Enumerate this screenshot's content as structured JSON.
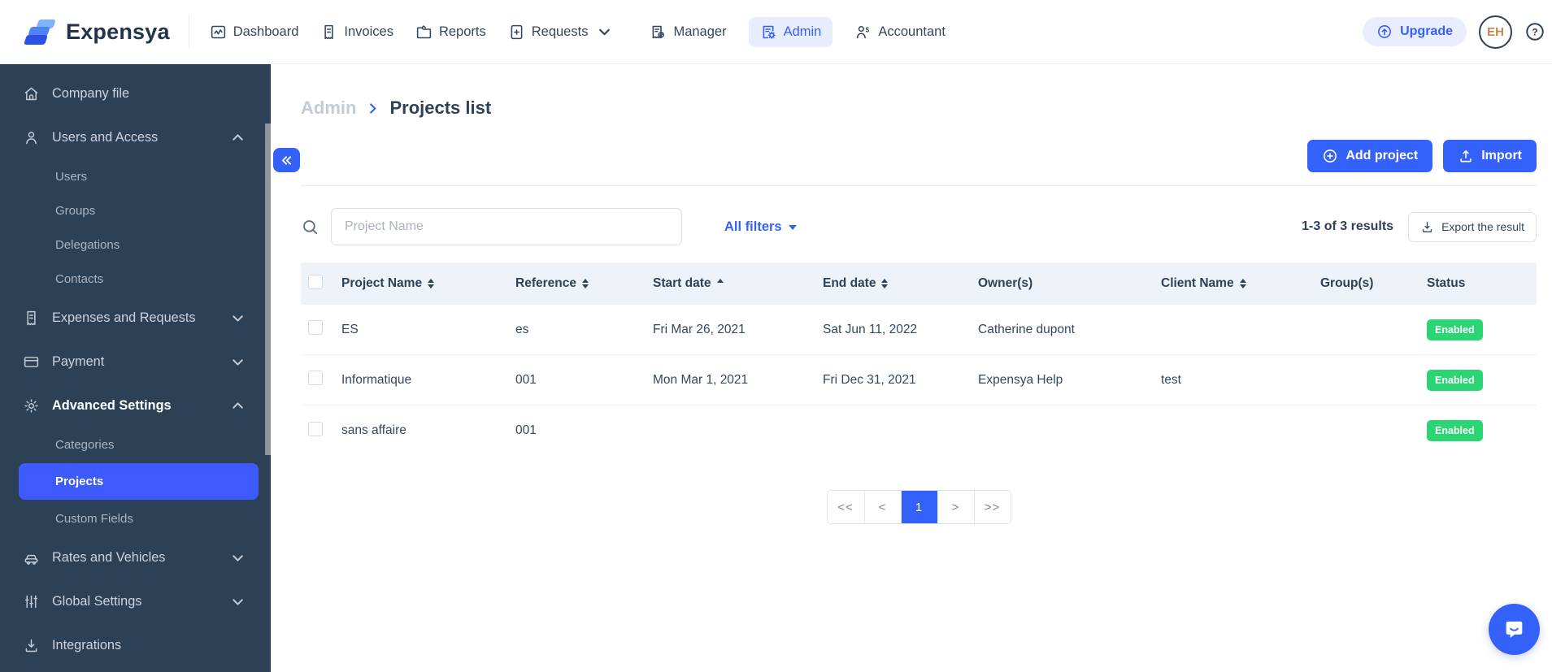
{
  "brand": {
    "name": "Expensya",
    "logo_icon": "expensya-logo-icon"
  },
  "topnav": {
    "items": [
      {
        "label": "Dashboard",
        "icon": "dashboard-icon",
        "active": false,
        "caret": false
      },
      {
        "label": "Invoices",
        "icon": "invoices-icon",
        "active": false,
        "caret": false
      },
      {
        "label": "Reports",
        "icon": "reports-icon",
        "active": false,
        "caret": false
      },
      {
        "label": "Requests",
        "icon": "requests-icon",
        "active": false,
        "caret": true
      },
      {
        "label": "Manager",
        "icon": "manager-icon",
        "active": false,
        "caret": false
      },
      {
        "label": "Admin",
        "icon": "admin-icon",
        "active": true,
        "caret": false
      },
      {
        "label": "Accountant",
        "icon": "accountant-icon",
        "active": false,
        "caret": false
      }
    ],
    "upgrade": {
      "label": "Upgrade",
      "icon": "upgrade-icon"
    },
    "avatar": {
      "initials": "EH"
    },
    "help_icon": "help-icon"
  },
  "sidebar": {
    "items": [
      {
        "label": "Company file",
        "icon": "home-icon"
      },
      {
        "label": "Users and Access",
        "icon": "user-icon",
        "expanded": true,
        "children": [
          {
            "label": "Users"
          },
          {
            "label": "Groups"
          },
          {
            "label": "Delegations"
          },
          {
            "label": "Contacts"
          }
        ]
      },
      {
        "label": "Expenses and Requests",
        "icon": "receipt-icon",
        "expanded": false
      },
      {
        "label": "Payment",
        "icon": "card-icon",
        "expanded": false
      },
      {
        "label": "Advanced Settings",
        "icon": "gear-icon",
        "expanded": true,
        "children": [
          {
            "label": "Categories"
          },
          {
            "label": "Projects",
            "active": true
          },
          {
            "label": "Custom Fields"
          }
        ]
      },
      {
        "label": "Rates and Vehicles",
        "icon": "car-icon",
        "expanded": false
      },
      {
        "label": "Global Settings",
        "icon": "sliders-icon",
        "expanded": false
      },
      {
        "label": "Integrations",
        "icon": "download-icon"
      }
    ]
  },
  "breadcrumb": {
    "parent": "Admin",
    "current": "Projects list"
  },
  "toolbar": {
    "add_project_label": "Add project",
    "import_label": "Import"
  },
  "filters": {
    "search_placeholder": "Project Name",
    "all_filters_label": "All filters",
    "results_text": "1-3 of 3 results",
    "export_label": "Export the result"
  },
  "table": {
    "columns": [
      {
        "label": "Project Name",
        "sort": "both"
      },
      {
        "label": "Reference",
        "sort": "both"
      },
      {
        "label": "Start date",
        "sort": "asc"
      },
      {
        "label": "End date",
        "sort": "both"
      },
      {
        "label": "Owner(s)",
        "sort": "none"
      },
      {
        "label": "Client Name",
        "sort": "both"
      },
      {
        "label": "Group(s)",
        "sort": "none"
      },
      {
        "label": "Status",
        "sort": "none"
      }
    ],
    "rows": [
      {
        "project_name": "ES",
        "reference": "es",
        "start_date": "Fri Mar 26, 2021",
        "end_date": "Sat Jun 11, 2022",
        "owners": "Catherine dupont",
        "client_name": "",
        "groups": "",
        "status": "Enabled"
      },
      {
        "project_name": "Informatique",
        "reference": "001",
        "start_date": "Mon Mar 1, 2021",
        "end_date": "Fri Dec 31, 2021",
        "owners": "Expensya Help",
        "client_name": "test",
        "groups": "",
        "status": "Enabled"
      },
      {
        "project_name": "sans affaire",
        "reference": "001",
        "start_date": "",
        "end_date": "",
        "owners": "",
        "client_name": "",
        "groups": "",
        "status": "Enabled"
      }
    ]
  },
  "pagination": {
    "first_label": "<<",
    "prev_label": "<",
    "current_page": "1",
    "next_label": ">",
    "last_label": ">>"
  },
  "colors": {
    "accent_blue": "#3561fb",
    "sidebar_bg": "#2d4156",
    "active_item_blue": "#3c5afd",
    "enabled_green": "#2bd573",
    "admin_pill_bg": "#e8edfe",
    "table_header_bg": "#eef2f9",
    "dark_text": "#2e4156",
    "muted_text": "#a9b2bd"
  }
}
